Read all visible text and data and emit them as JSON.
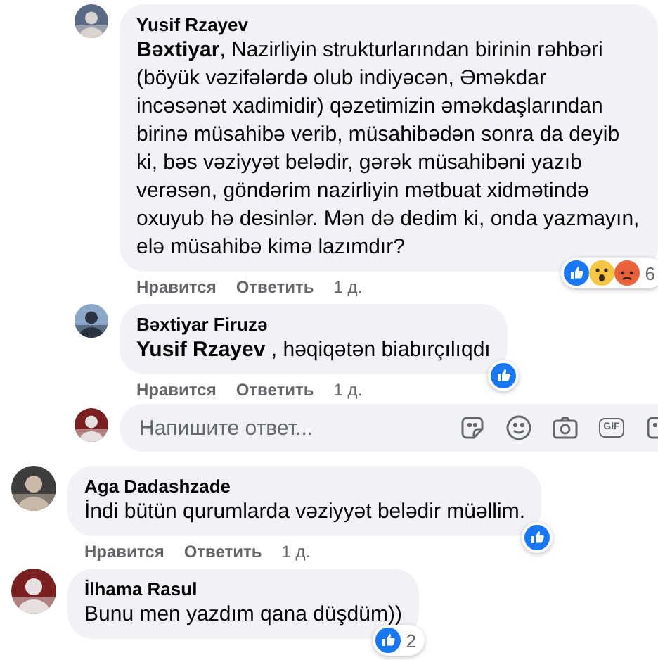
{
  "replies": [
    {
      "author": "Yusif Rzayev",
      "text": "**Bəxtiyar**, Nazirliyin strukturlarından birinin rəhbəri (böyük vəzifələrdə olub indiyəcən, Əməkdar incəsənət xadimidir) qəzetimizin əməkdaşlarından birinə müsahibə verib, müsahibədən sonra da deyib ki, bəs vəziyyət belədir, gərək müsahibəni yazıb verəsən, göndərim nazirliyin mətbuat xidmətində oxuyub hə desinlər. Mən də dedim ki, onda yazmayın, elə müsahibə kimə lazımdır?",
      "reactions": [
        {
          "kind": "like"
        },
        {
          "kind": "wow"
        },
        {
          "kind": "angry"
        }
      ],
      "reaction_count": "6",
      "actions": [
        "Нравится",
        "Ответить"
      ],
      "time": "1 д."
    },
    {
      "author": "Bəxtiyar Firuzə",
      "text": "**Yusif Rzayev** , həqiqətən biabırçılıqdı",
      "reactions": [
        {
          "kind": "like"
        }
      ],
      "actions": [
        "Нравится",
        "Ответить"
      ],
      "time": "1 д."
    }
  ],
  "reply_composer": {
    "placeholder": "Напишите ответ...",
    "tools": [
      {
        "kind": "sticker"
      },
      {
        "kind": "emoji"
      },
      {
        "kind": "camera"
      },
      {
        "kind": "gif",
        "label": "GIF"
      },
      {
        "kind": "sticker"
      }
    ]
  },
  "comments": [
    {
      "author": "Aga Dadashzade",
      "text": "İndi bütün qurumlarda vəziyyət belədir müəllim.",
      "reactions": [
        {
          "kind": "like"
        }
      ],
      "actions": [
        "Нравится",
        "Ответить"
      ],
      "time": "1 д."
    },
    {
      "author": "İlhama Rasul",
      "text": "Bunu men yazdım qana düşdüm))",
      "reactions": [
        {
          "kind": "like"
        }
      ],
      "reaction_count": "2"
    }
  ]
}
